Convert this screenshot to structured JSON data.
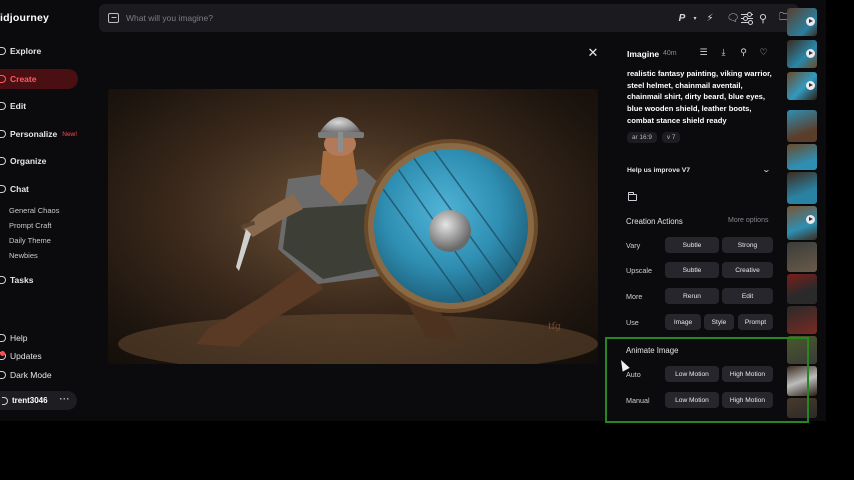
{
  "app": {
    "logo": "idjourney"
  },
  "sidebar": {
    "nav": [
      {
        "label": "Explore"
      },
      {
        "label": "Create"
      },
      {
        "label": "Edit"
      },
      {
        "label": "Personalize",
        "badge": "New!"
      },
      {
        "label": "Organize"
      },
      {
        "label": "Chat"
      }
    ],
    "chat_rooms": [
      "General Chaos",
      "Prompt Craft",
      "Daily Theme",
      "Newbies"
    ],
    "tasks": "Tasks",
    "bottom": [
      "Help",
      "Updates",
      "Dark Mode"
    ],
    "user": {
      "name": "trent3046",
      "more": "···"
    }
  },
  "topbar": {
    "placeholder": "What will you imagine?",
    "icons": [
      "image-icon",
      "sliders-icon",
      "profile-p-icon",
      "lightning-icon",
      "chat-icon",
      "search-icon",
      "folder-icon"
    ]
  },
  "detail": {
    "title": "Imagine",
    "age": "40m",
    "prompt": "realistic fantasy painting, viking warrior, steel helmet, chainmail aventail, chainmail shirt, dirty beard, blue eyes, blue wooden shield, leather boots, combat stance shield ready",
    "params": [
      "ar 16:9",
      "v 7"
    ],
    "improve": "Help us improve V7",
    "creation_actions": {
      "title": "Creation Actions",
      "more": "More options",
      "rows": [
        {
          "label": "Vary",
          "buttons": [
            "Subtle",
            "Strong"
          ]
        },
        {
          "label": "Upscale",
          "buttons": [
            "Subtle",
            "Creative"
          ]
        },
        {
          "label": "More",
          "buttons": [
            "Rerun",
            "Edit"
          ]
        },
        {
          "label": "Use",
          "buttons": [
            "Image",
            "Style",
            "Prompt"
          ]
        }
      ]
    },
    "animate": {
      "title": "Animate Image",
      "rows": [
        {
          "label": "Auto",
          "buttons": [
            "Low Motion",
            "High Motion"
          ]
        },
        {
          "label": "Manual",
          "buttons": [
            "Low Motion",
            "High Motion"
          ]
        }
      ]
    }
  },
  "colors": {
    "background": "#0b0b0d",
    "create_accent": "#ff5a5f",
    "shield_blue": "#2f8fb3",
    "highlight_green": "#27871f"
  }
}
